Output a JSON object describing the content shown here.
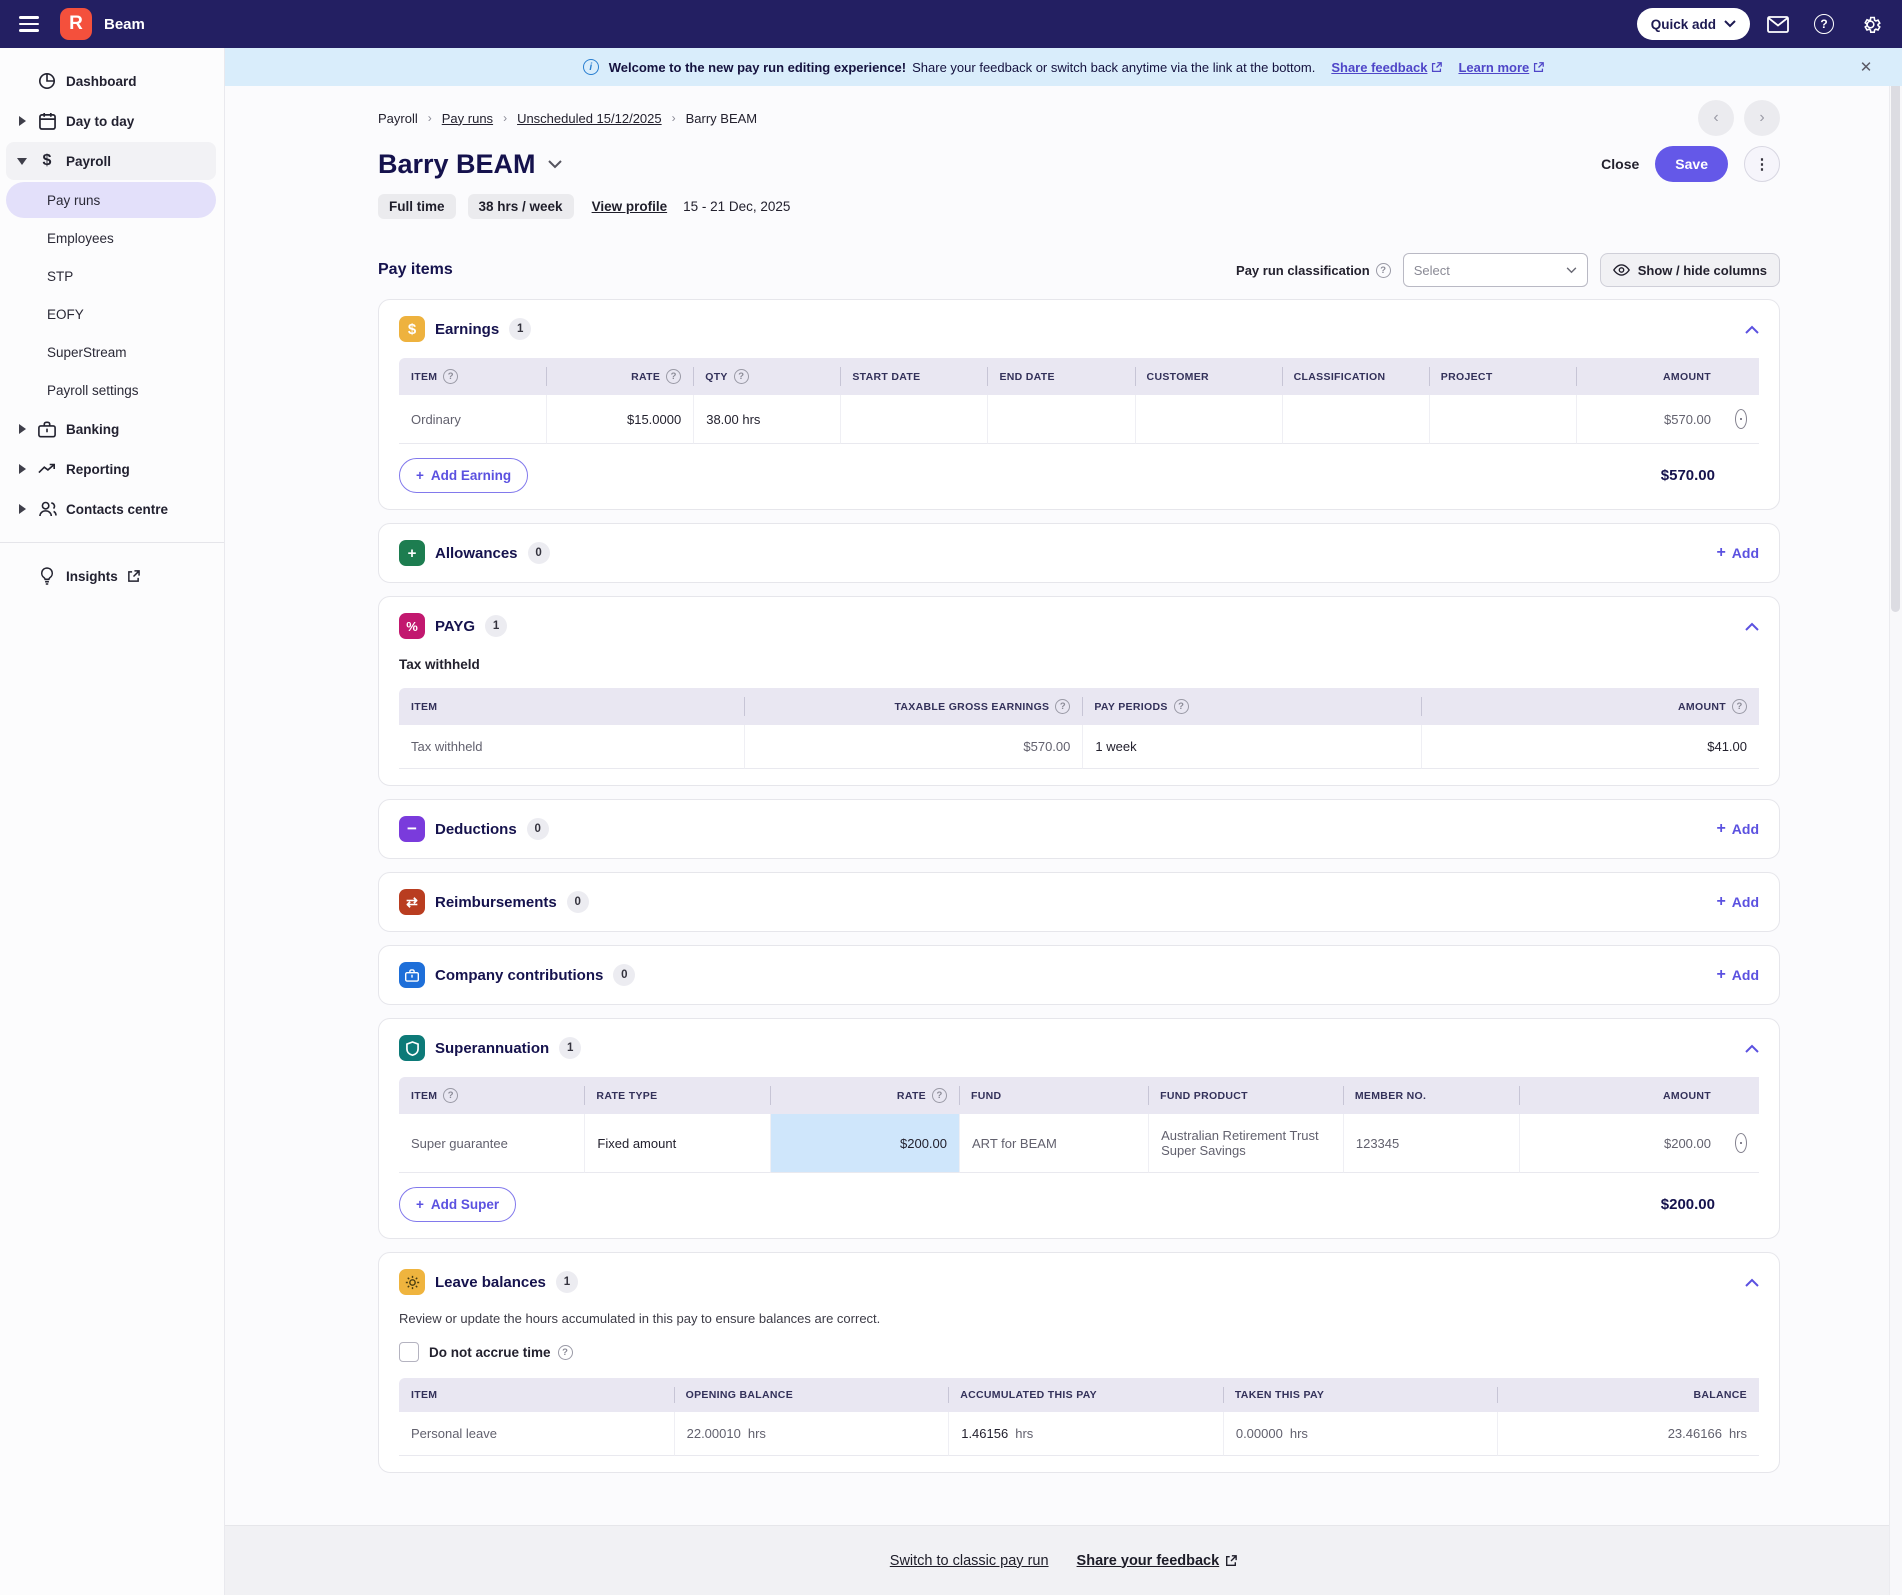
{
  "colors": {
    "navbar": "#231f62",
    "logo": "#f4503c",
    "accent": "#5b51e0",
    "save": "#6458e8",
    "banner_bg": "#d9edfb",
    "table_head_bg": "#e9e7f2",
    "highlight_cell": "#cfe6fb"
  },
  "navbar": {
    "product": "Beam",
    "quick_add": "Quick add"
  },
  "sidebar": {
    "items": [
      {
        "label": "Dashboard"
      },
      {
        "label": "Day to day"
      },
      {
        "label": "Payroll"
      },
      {
        "label": "Banking"
      },
      {
        "label": "Reporting"
      },
      {
        "label": "Contacts centre"
      },
      {
        "label": "Insights"
      }
    ],
    "payroll_children": [
      "Pay runs",
      "Employees",
      "STP",
      "EOFY",
      "SuperStream",
      "Payroll settings"
    ]
  },
  "banner": {
    "lead": "Welcome to the new pay run editing experience!",
    "body": "Share your feedback or switch back anytime via the link at the bottom.",
    "share": "Share feedback",
    "learn": "Learn more"
  },
  "breadcrumb": [
    "Payroll",
    "Pay runs",
    "Unscheduled 15/12/2025",
    "Barry BEAM"
  ],
  "header": {
    "title": "Barry BEAM",
    "close": "Close",
    "save": "Save"
  },
  "employee": {
    "type": "Full time",
    "hours": "38 hrs / week",
    "view_profile": "View profile",
    "period": "15 - 21 Dec, 2025"
  },
  "pay_items": {
    "title": "Pay items",
    "classification_label": "Pay run classification",
    "classification_placeholder": "Select",
    "show_hide": "Show / hide columns"
  },
  "earnings": {
    "title": "Earnings",
    "count": "1",
    "columns": [
      "Item",
      "Rate",
      "Qty",
      "Start date",
      "End date",
      "Customer",
      "Classification",
      "Project",
      "Amount"
    ],
    "row": {
      "item": "Ordinary",
      "rate": "$15.0000",
      "qty": "38.00 hrs",
      "start_date": "",
      "end_date": "",
      "customer": "",
      "classification": "",
      "project": "",
      "amount": "$570.00"
    },
    "add_label": "Add Earning",
    "total": "$570.00"
  },
  "allowances": {
    "title": "Allowances",
    "count": "0",
    "add_label": "Add"
  },
  "payg": {
    "title": "PAYG",
    "count": "1",
    "subtitle": "Tax withheld",
    "columns": [
      "Item",
      "Taxable gross earnings",
      "Pay periods",
      "Amount"
    ],
    "row": {
      "item": "Tax withheld",
      "taxable": "$570.00",
      "periods": "1 week",
      "amount": "$41.00"
    }
  },
  "deductions": {
    "title": "Deductions",
    "count": "0",
    "add_label": "Add"
  },
  "reimbursements": {
    "title": "Reimbursements",
    "count": "0",
    "add_label": "Add"
  },
  "company": {
    "title": "Company contributions",
    "count": "0",
    "add_label": "Add"
  },
  "superannuation": {
    "title": "Superannuation",
    "count": "1",
    "columns": [
      "Item",
      "Rate type",
      "Rate",
      "Fund",
      "Fund product",
      "Member no.",
      "Amount"
    ],
    "row": {
      "item": "Super guarantee",
      "rate_type": "Fixed amount",
      "rate": "$200.00",
      "fund": "ART for BEAM",
      "fund_product": "Australian Retirement Trust Super Savings",
      "member_no": "123345",
      "amount": "$200.00"
    },
    "add_label": "Add Super",
    "total": "$200.00"
  },
  "leave": {
    "title": "Leave balances",
    "count": "1",
    "description": "Review or update the hours accumulated in this pay to ensure balances are correct.",
    "checkbox_label": "Do not accrue time",
    "columns": [
      "Item",
      "Opening balance",
      "Accumulated this pay",
      "Taken this pay",
      "Balance"
    ],
    "row": {
      "item": "Personal leave",
      "opening": "22.00010",
      "accumulated": "1.46156",
      "taken": "0.00000",
      "balance": "23.46166",
      "unit": "hrs"
    }
  },
  "footer": {
    "classic": "Switch to classic pay run",
    "feedback": "Share your feedback"
  }
}
